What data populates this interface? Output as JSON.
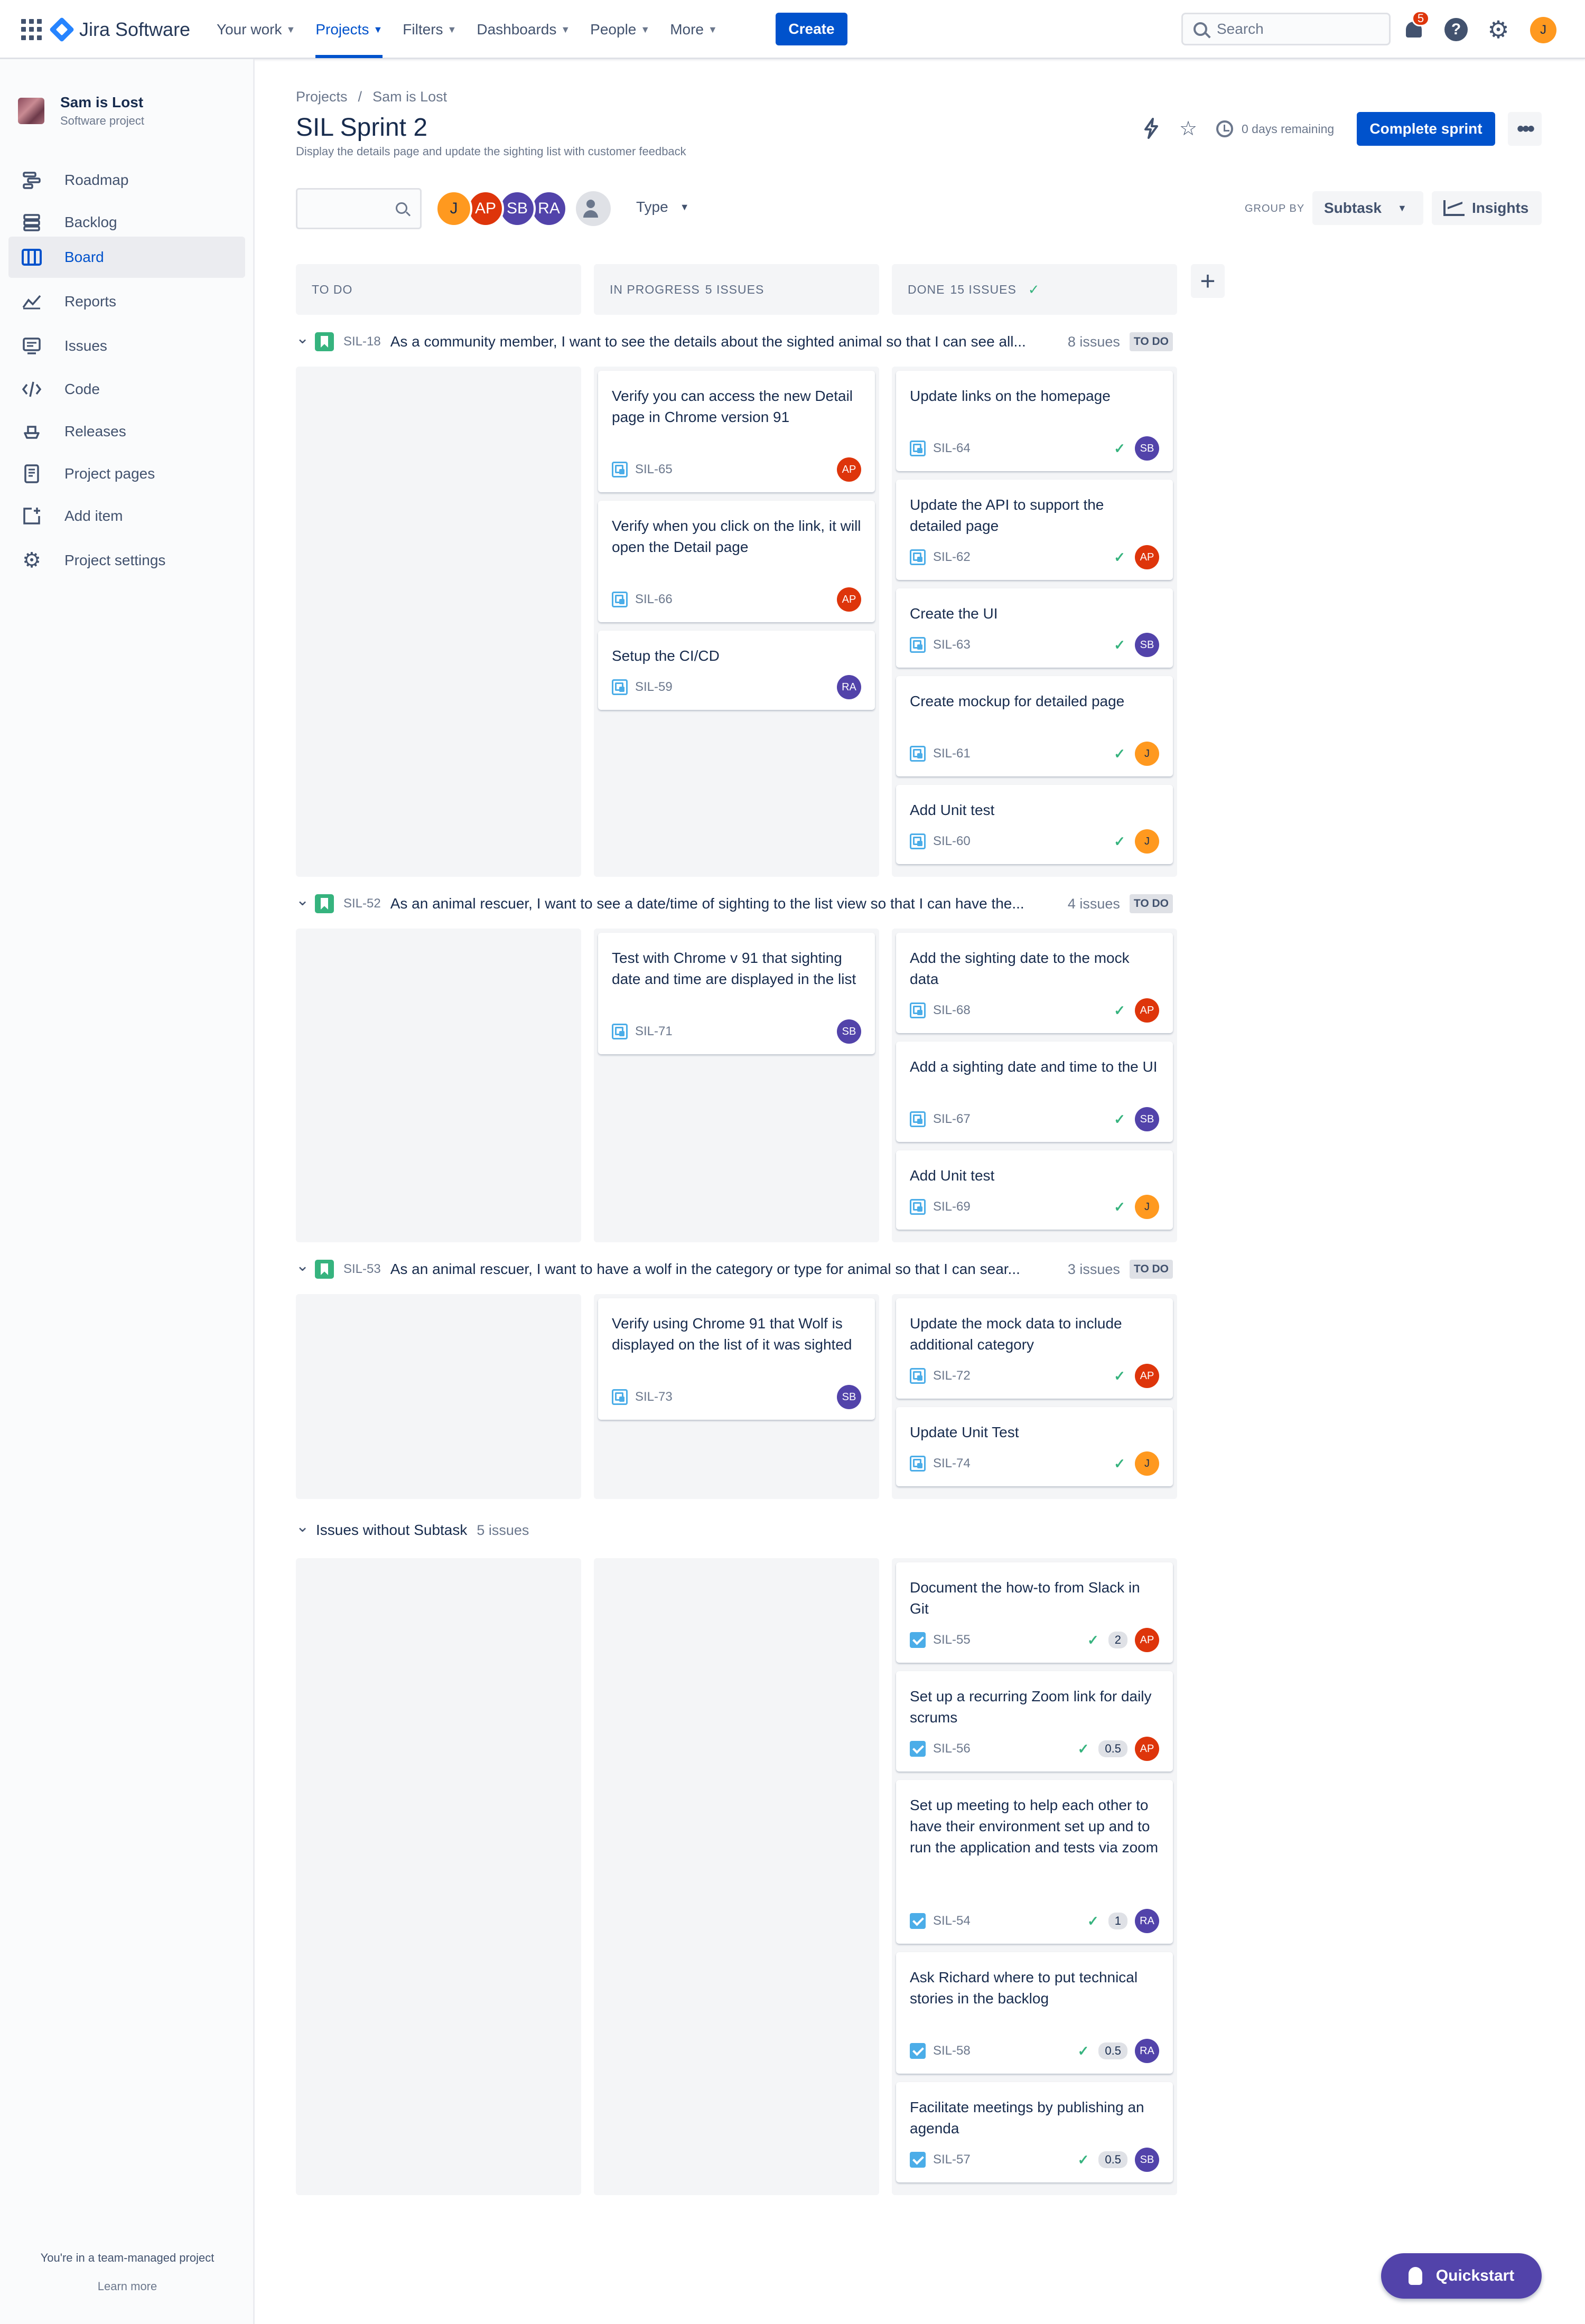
{
  "topnav": {
    "product": "Jira Software",
    "items": [
      {
        "label": "Your work",
        "active": false
      },
      {
        "label": "Projects",
        "active": true
      },
      {
        "label": "Filters",
        "active": false
      },
      {
        "label": "Dashboards",
        "active": false
      },
      {
        "label": "People",
        "active": false
      },
      {
        "label": "More",
        "active": false
      }
    ],
    "create_label": "Create",
    "search_placeholder": "Search",
    "notification_count": "5",
    "help_glyph": "?",
    "user_initial": "J"
  },
  "sidebar": {
    "project_name": "Sam is Lost",
    "project_type": "Software project",
    "items": [
      {
        "label": "Roadmap",
        "icon": "roadmap-icon",
        "active": false
      },
      {
        "label": "Backlog",
        "icon": "backlog-icon",
        "active": false
      },
      {
        "label": "Board",
        "icon": "board-icon",
        "active": true
      },
      {
        "label": "Reports",
        "icon": "reports-icon",
        "active": false
      },
      {
        "label": "Issues",
        "icon": "issues-icon",
        "active": false
      },
      {
        "label": "Code",
        "icon": "code-icon",
        "active": false
      },
      {
        "label": "Releases",
        "icon": "releases-icon",
        "active": false
      },
      {
        "label": "Project pages",
        "icon": "project-pages-icon",
        "active": false
      },
      {
        "label": "Add item",
        "icon": "add-item-icon",
        "active": false
      },
      {
        "label": "Project settings",
        "icon": "gear-icon",
        "active": false
      }
    ],
    "footer_text": "You're in a team-managed project",
    "footer_link": "Learn more"
  },
  "header": {
    "breadcrumb": [
      "Projects",
      "Sam is Lost"
    ],
    "title": "SIL Sprint 2",
    "subtitle": "Display the details page and update the sighting list with customer feedback",
    "days_remaining": "0 days remaining",
    "complete_label": "Complete sprint",
    "more_glyph": "•••"
  },
  "filters": {
    "people": [
      {
        "initials": "J",
        "color": "#FF991F",
        "text_color": "#172B4D"
      },
      {
        "initials": "AP",
        "color": "#DE350B",
        "text_color": "#FFFFFF"
      },
      {
        "initials": "SB",
        "color": "#5243AA",
        "text_color": "#FFFFFF"
      },
      {
        "initials": "RA",
        "color": "#5243AA",
        "text_color": "#FFFFFF"
      }
    ],
    "type_label": "Type",
    "group_by_label": "GROUP BY",
    "group_by_value": "Subtask",
    "insights_label": "Insights"
  },
  "columns": [
    {
      "label": "TO DO",
      "count": ""
    },
    {
      "label": "IN PROGRESS",
      "count": "5 ISSUES"
    },
    {
      "label": "DONE",
      "count": "15 ISSUES"
    }
  ],
  "swimlanes": [
    {
      "key": "SIL-18",
      "title": "As a community member, I want to see the details about the sighted animal so that I can see all...",
      "count": "8 issues",
      "status": "TO DO",
      "in_progress": [
        {
          "title": "Verify you can access the new Detail page in Chrome version 91",
          "key": "SIL-65",
          "assignee": "AP"
        },
        {
          "title": "Verify when you click on the link, it will open the Detail page",
          "key": "SIL-66",
          "assignee": "AP"
        },
        {
          "title": "Setup the CI/CD",
          "key": "SIL-59",
          "assignee": "RA"
        }
      ],
      "done": [
        {
          "title": "Update links on the homepage",
          "key": "SIL-64",
          "assignee": "SB"
        },
        {
          "title": "Update the API to support the detailed page",
          "key": "SIL-62",
          "assignee": "AP"
        },
        {
          "title": "Create the UI",
          "key": "SIL-63",
          "assignee": "SB"
        },
        {
          "title": "Create mockup for detailed page",
          "key": "SIL-61",
          "assignee": "J"
        },
        {
          "title": "Add Unit test",
          "key": "SIL-60",
          "assignee": "J"
        }
      ]
    },
    {
      "key": "SIL-52",
      "title": "As an animal rescuer, I want to see a date/time of sighting to the list view so that I can have the...",
      "count": "4 issues",
      "status": "TO DO",
      "in_progress": [
        {
          "title": "Test with Chrome v 91 that sighting date and time are displayed in the list",
          "key": "SIL-71",
          "assignee": "SB"
        }
      ],
      "done": [
        {
          "title": "Add the sighting date to the mock data",
          "key": "SIL-68",
          "assignee": "AP"
        },
        {
          "title": "Add a sighting date and time to the UI",
          "key": "SIL-67",
          "assignee": "SB"
        },
        {
          "title": "Add Unit test",
          "key": "SIL-69",
          "assignee": "J"
        }
      ]
    },
    {
      "key": "SIL-53",
      "title": "As an animal rescuer, I want to have a wolf in the category or type for animal so that I can sear...",
      "count": "3 issues",
      "status": "TO DO",
      "in_progress": [
        {
          "title": "Verify using Chrome 91 that Wolf is displayed on the list of it was sighted",
          "key": "SIL-73",
          "assignee": "SB"
        }
      ],
      "done": [
        {
          "title": "Update the mock data to include additional category",
          "key": "SIL-72",
          "assignee": "AP"
        },
        {
          "title": "Update Unit Test",
          "key": "SIL-74",
          "assignee": "J"
        }
      ]
    }
  ],
  "no_subtask": {
    "title": "Issues without Subtask",
    "count": "5 issues",
    "done": [
      {
        "title": "Document the how-to from Slack in Git",
        "key": "SIL-55",
        "estimate": "2",
        "assignee": "AP"
      },
      {
        "title": "Set up a recurring Zoom link for daily scrums",
        "key": "SIL-56",
        "estimate": "0.5",
        "assignee": "AP"
      },
      {
        "title": "Set up meeting to help each other to have their environment set up and to run the application and tests via zoom",
        "key": "SIL-54",
        "estimate": "1",
        "assignee": "RA"
      },
      {
        "title": "Ask Richard where to put technical stories in the backlog",
        "key": "SIL-58",
        "estimate": "0.5",
        "assignee": "RA"
      },
      {
        "title": "Facilitate meetings by publishing an agenda",
        "key": "SIL-57",
        "estimate": "0.5",
        "assignee": "SB"
      }
    ]
  },
  "avatar_colors": {
    "J": {
      "bg": "#FF991F",
      "fg": "#172B4D"
    },
    "AP": {
      "bg": "#DE350B",
      "fg": "#FFFFFF"
    },
    "SB": {
      "bg": "#5243AA",
      "fg": "#FFFFFF"
    },
    "RA": {
      "bg": "#5243AA",
      "fg": "#FFFFFF"
    }
  },
  "quickstart_label": "Quickstart"
}
